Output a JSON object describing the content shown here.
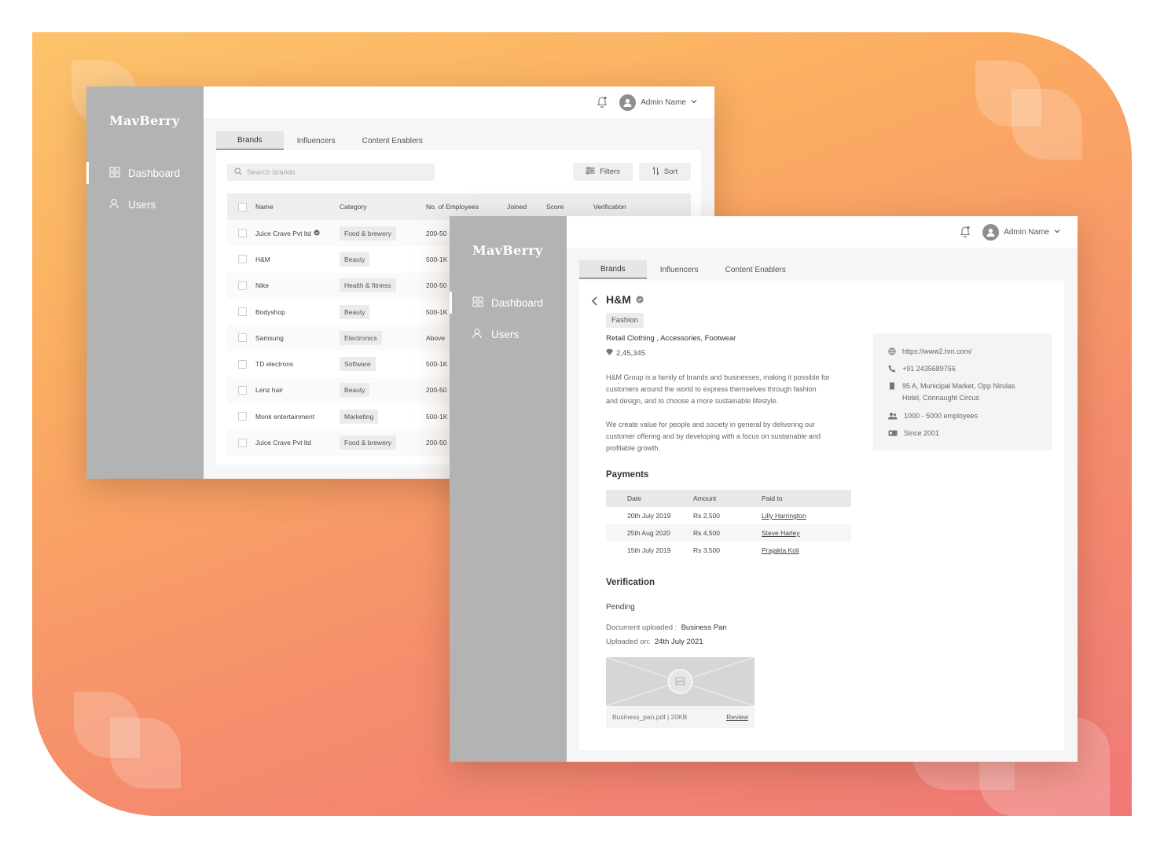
{
  "brand": "MavBerry",
  "nav": {
    "dashboard": "Dashboard",
    "users": "Users"
  },
  "admin_name": "Admin Name",
  "tabs": [
    "Brands",
    "Influencers",
    "Content Enablers"
  ],
  "list": {
    "search_placeholder": "Search brands",
    "filters_label": "Filters",
    "sort_label": "Sort",
    "columns": [
      "Name",
      "Category",
      "No. of Employees",
      "Joined",
      "Score",
      "Verification"
    ],
    "rows": [
      {
        "name": "Juice Crave Pvt ltd",
        "category": "Food & brewery",
        "employees": "200-50"
      },
      {
        "name": "H&M",
        "category": "Beauty",
        "employees": "500-1K"
      },
      {
        "name": "Nike",
        "category": "Health & fitness",
        "employees": "200-50"
      },
      {
        "name": "Bodyshop",
        "category": "Beauty",
        "employees": "500-1K"
      },
      {
        "name": "Samsung",
        "category": "Electronics",
        "employees": "Above"
      },
      {
        "name": "TD electrons",
        "category": "Software",
        "employees": "500-1K"
      },
      {
        "name": "Lenz hair",
        "category": "Beauty",
        "employees": "200-50"
      },
      {
        "name": "Monk entertainment",
        "category": "Marketing",
        "employees": "500-1K"
      },
      {
        "name": "Juice Crave Pvt ltd",
        "category": "Food & brewery",
        "employees": "200-50"
      }
    ]
  },
  "detail": {
    "name": "H&M",
    "tag": "Fashion",
    "categories": "Retail Clothing , Accessories, Footwear",
    "followers": "2,45,345",
    "desc1_line1": "H&M Group is a family of brands and businesses, making it possible for",
    "desc1_line2": "customers around the world to express themselves through fashion",
    "desc1_line3": "and design, and to choose a more sustainable lifestyle.",
    "desc2_line1": "We create value for people and society in general by delivering our",
    "desc2_line2": "customer offering and by developing with a focus on sustainable and",
    "desc2_line3": "profitable growth.",
    "website": "https://www2.hm.com/",
    "phone": "+91 2435689756",
    "address_line1": "95 A, Municipal Market, Opp Nirulas",
    "address_line2": "Hotel, Connaught Circus",
    "employees": "1000 - 5000 employees",
    "since": "Since 2001",
    "payments_title": "Payments",
    "payment_columns": [
      "Date",
      "Amount",
      "Paid to"
    ],
    "payments": [
      {
        "date": "20th July 2019",
        "amount": "Rs 2,500",
        "paid_to": "Lilly Harrington"
      },
      {
        "date": "25th Aug 2020",
        "amount": "Rs 4,500",
        "paid_to": "Steve Harley"
      },
      {
        "date": "15th July 2019",
        "amount": "Rs 3,500",
        "paid_to": "Prajakta Koli"
      }
    ],
    "verification_title": "Verification",
    "verification_status": "Pending",
    "doc_label": "Document uploaded :",
    "doc_value": "Business Pan",
    "uploaded_label": "Uploaded on:",
    "uploaded_value": "24th July 2021",
    "file_info": "Business_pan.pdf | 20KB",
    "review_label": "Review"
  },
  "colors": {
    "sidebar": "#b3b3b3",
    "gradient_start": "#fdc36b",
    "gradient_end": "#f07978"
  }
}
